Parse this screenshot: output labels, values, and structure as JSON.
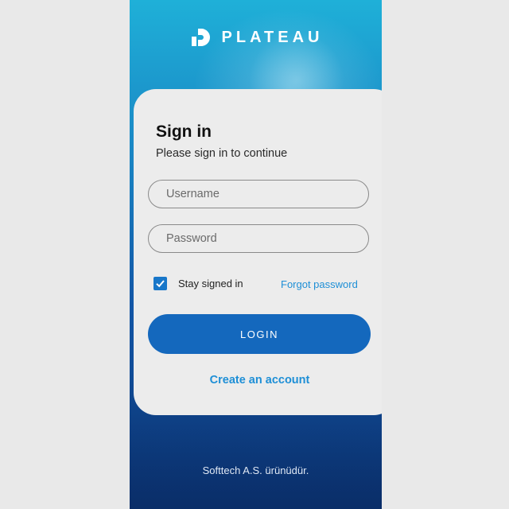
{
  "brand": {
    "name": "PLATEAU",
    "logo_icon": "plateau-logo-icon"
  },
  "signin": {
    "title": "Sign in",
    "subtitle": "Please sign in to continue",
    "username_placeholder": "Username",
    "password_placeholder": "Password",
    "stay_signed_in_label": "Stay signed in",
    "stay_signed_in_checked": true,
    "forgot_password_label": "Forgot password",
    "login_button_label": "LOGIN",
    "create_account_label": "Create an account"
  },
  "footer": {
    "text": "Softtech A.S. ürünüdür."
  },
  "colors": {
    "primary": "#1468bd",
    "link": "#1e8fd6",
    "card_background": "#ececec",
    "page_background": "#e9e9e9"
  }
}
